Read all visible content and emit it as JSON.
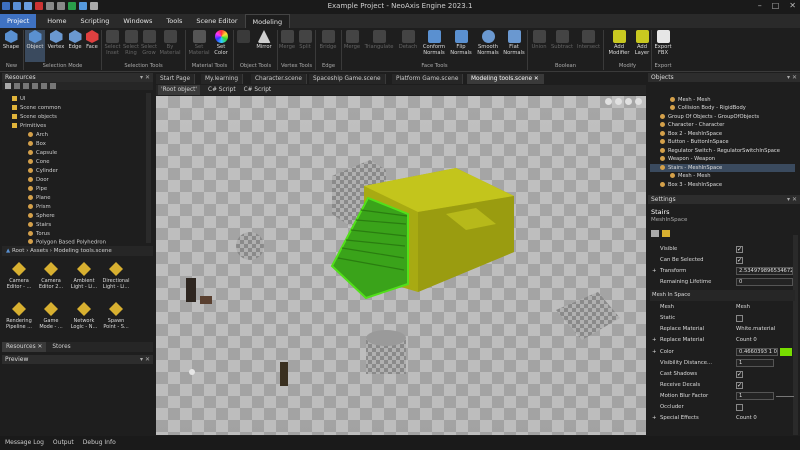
{
  "window": {
    "title": "Example Project - NeoAxis Engine 2023.1"
  },
  "menu": {
    "tabs": [
      "Project",
      "Home",
      "Scripting",
      "Windows",
      "Tools",
      "Scene Editor",
      "Modeling"
    ]
  },
  "ribbon": {
    "buttons": [
      "Shape",
      "Object",
      "Vertex",
      "Edge",
      "Face",
      "Select Inset",
      "Select Ring",
      "Select Grow",
      "By Material",
      "Set Material",
      "Set Color",
      "Mirror",
      "Merge",
      "Split",
      "Bridge",
      "Merge",
      "Triangulate",
      "Detach",
      "Conform Normals",
      "Flip Normals",
      "Smooth Normals",
      "Flat Normals",
      "Union",
      "Subtract",
      "Intersect",
      "Add Modifier",
      "Add Layer",
      "Export FBX"
    ],
    "groups": [
      "New",
      "Selection Mode",
      "Selection Tools",
      "Material Tools",
      "Object Tools",
      "Vertex Tools",
      "Edge",
      "Face Tools",
      "Boolean",
      "Modify",
      "Export"
    ]
  },
  "resources": {
    "title": "Resources",
    "tree": [
      "UI",
      "Scene common",
      "Scene objects",
      "Primitives",
      "Arch",
      "Box",
      "Capsule",
      "Cone",
      "Cylinder",
      "Door",
      "Pipe",
      "Plane",
      "Prism",
      "Sphere",
      "Stairs",
      "Torus",
      "Polygon Based Polyhedron"
    ],
    "breadcrumb": [
      "Root",
      "Assets",
      "Modeling tools.scene"
    ],
    "assets": [
      "Camera Editor - ...",
      "Camera Editor 2...",
      "Ambient Light - Li...",
      "Directional Light - Li...",
      "Rendering Pipeline ...",
      "Game Mode - ...",
      "Network Logic - N...",
      "Spawn Point - S..."
    ],
    "tabs": [
      "Resources",
      "Stores"
    ]
  },
  "preview": {
    "title": "Preview"
  },
  "documents": {
    "tabs": [
      "Start Page",
      "My.learning",
      "Character.scene",
      "Spaceship Game.scene",
      "Platform Game.scene",
      "Modeling tools.scene"
    ],
    "subtabs": [
      "'Root object'",
      "C# Script",
      "C# Script"
    ]
  },
  "objects": {
    "title": "Objects",
    "rows": [
      "Mesh - Mesh",
      "Collision Body - RigidBody",
      "Group Of Objects - GroupOfObjects",
      "Character - Character",
      "Box 2 - MeshInSpace",
      "Button - ButtonInSpace",
      "Regulator Switch - RegulatorSwitchInSpace",
      "Weapon - Weapon",
      "Stairs - MeshInSpace",
      "Mesh - Mesh",
      "Box 3 - MeshInSpace"
    ]
  },
  "settings": {
    "title": "Settings",
    "object_name": "Stairs",
    "object_type": "MeshInSpace",
    "rows": [
      {
        "name": "Visible",
        "value": ""
      },
      {
        "name": "Can Be Selected",
        "value": ""
      },
      {
        "name": "Transform",
        "value": "2.534979896534672"
      },
      {
        "name": "Remaining Lifetime",
        "value": "0"
      },
      {
        "name": "Mesh In Space",
        "value": ""
      },
      {
        "name": "Mesh",
        "value": "Mesh"
      },
      {
        "name": "Static",
        "value": ""
      },
      {
        "name": "Replace Material",
        "value": "White.material"
      },
      {
        "name": "Replace Material",
        "value": "Count 0"
      },
      {
        "name": "Color",
        "value": "0.4660393 1 0"
      },
      {
        "name": "Visibility Distance...",
        "value": "1"
      },
      {
        "name": "Cast Shadows",
        "value": ""
      },
      {
        "name": "Receive Decals",
        "value": ""
      },
      {
        "name": "Motion Blur Factor",
        "value": "1"
      },
      {
        "name": "Occluder",
        "value": ""
      },
      {
        "name": "Special Effects",
        "value": "Count 0"
      }
    ]
  },
  "status": {
    "items": [
      "Message Log",
      "Output",
      "Debug Info"
    ]
  },
  "colors": {
    "accent": "#3f72c2",
    "selection": "#52c41a",
    "block": "#a8aa12",
    "color_swatch": "#77dd00"
  }
}
